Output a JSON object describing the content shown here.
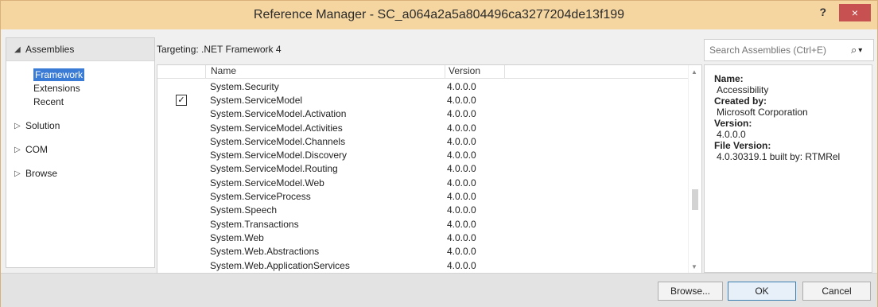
{
  "window": {
    "title": "Reference Manager - SC_a064a2a5a804496ca3277204de13f199",
    "help_label": "?",
    "close_label": "×"
  },
  "sidebar": {
    "assemblies": {
      "label": "Assemblies",
      "arrow": "◢"
    },
    "subitems": [
      "Framework",
      "Extensions",
      "Recent"
    ],
    "selected": "Framework",
    "nodes": [
      {
        "label": "Solution",
        "arrow": "▷"
      },
      {
        "label": "COM",
        "arrow": "▷"
      },
      {
        "label": "Browse",
        "arrow": "▷"
      }
    ]
  },
  "targeting": "Targeting: .NET Framework 4",
  "search": {
    "placeholder": "Search Assemblies (Ctrl+E)",
    "icon": "search-icon",
    "dropdown": "▾"
  },
  "grid": {
    "columns": {
      "name": "Name",
      "version": "Version"
    },
    "rows": [
      {
        "name": "System.Security",
        "version": "4.0.0.0",
        "checked": false
      },
      {
        "name": "System.ServiceModel",
        "version": "4.0.0.0",
        "checked": true
      },
      {
        "name": "System.ServiceModel.Activation",
        "version": "4.0.0.0",
        "checked": false
      },
      {
        "name": "System.ServiceModel.Activities",
        "version": "4.0.0.0",
        "checked": false
      },
      {
        "name": "System.ServiceModel.Channels",
        "version": "4.0.0.0",
        "checked": false
      },
      {
        "name": "System.ServiceModel.Discovery",
        "version": "4.0.0.0",
        "checked": false
      },
      {
        "name": "System.ServiceModel.Routing",
        "version": "4.0.0.0",
        "checked": false
      },
      {
        "name": "System.ServiceModel.Web",
        "version": "4.0.0.0",
        "checked": false
      },
      {
        "name": "System.ServiceProcess",
        "version": "4.0.0.0",
        "checked": false
      },
      {
        "name": "System.Speech",
        "version": "4.0.0.0",
        "checked": false
      },
      {
        "name": "System.Transactions",
        "version": "4.0.0.0",
        "checked": false
      },
      {
        "name": "System.Web",
        "version": "4.0.0.0",
        "checked": false
      },
      {
        "name": "System.Web.Abstractions",
        "version": "4.0.0.0",
        "checked": false
      },
      {
        "name": "System.Web.ApplicationServices",
        "version": "4.0.0.0",
        "checked": false
      }
    ]
  },
  "details": {
    "name_label": "Name:",
    "name_value": "Accessibility",
    "created_label": "Created by:",
    "created_value": "Microsoft Corporation",
    "version_label": "Version:",
    "version_value": "4.0.0.0",
    "file_version_label": "File Version:",
    "file_version_value": "4.0.30319.1 built by: RTMRel"
  },
  "buttons": {
    "browse": "Browse...",
    "ok": "OK",
    "cancel": "Cancel"
  },
  "colors": {
    "titlebar": "#f5d6a1",
    "close": "#c75050",
    "selection": "#3a7bd5"
  }
}
